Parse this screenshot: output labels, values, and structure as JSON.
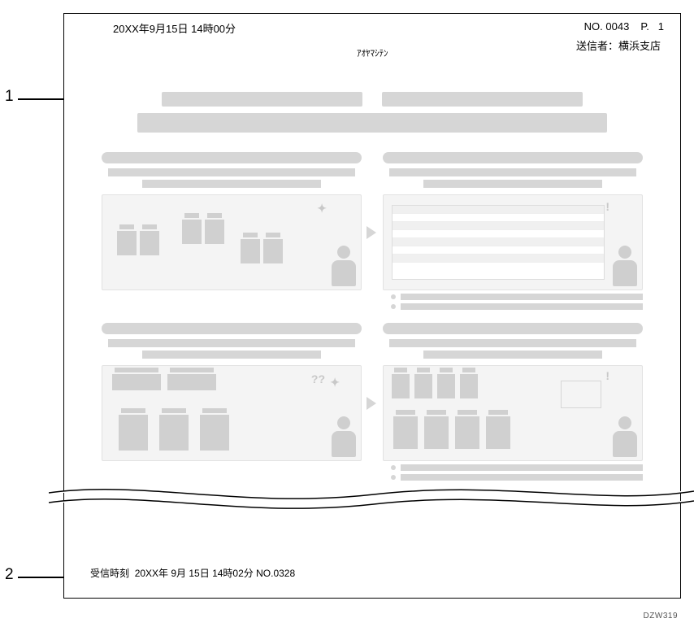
{
  "header": {
    "datetime": "20XX年9月15日  14時00分",
    "number_label": "NO.",
    "number": "0043",
    "page_label": "P.",
    "page": "1",
    "sender_label": "送信者：",
    "sender_name": "横浜支店"
  },
  "annotation": {
    "text": "ｱｵﾔﾏｼﾃﾝ"
  },
  "callouts": {
    "c1": "1",
    "c2": "2"
  },
  "footer": {
    "rx_label": "受信時刻",
    "rx_datetime": "20XX年 9月 15日 14時02分",
    "rx_no_label": "NO.",
    "rx_no": "0328"
  },
  "figure_id": "DZW319"
}
